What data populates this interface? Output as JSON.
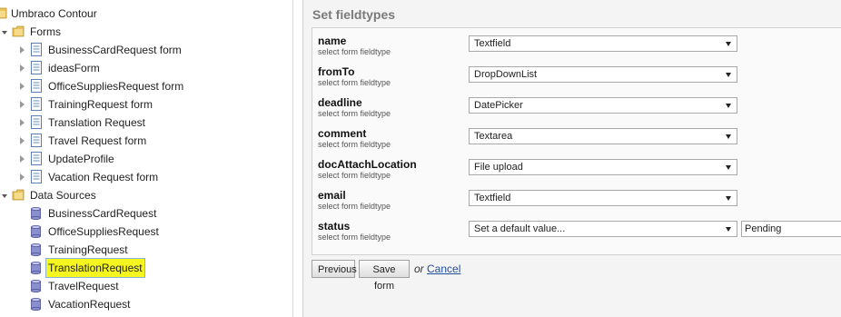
{
  "tree": {
    "root_label": "Umbraco Contour",
    "forms_label": "Forms",
    "forms": [
      "BusinessCardRequest form",
      "ideasForm",
      "OfficeSuppliesRequest form",
      "TrainingRequest form",
      "Translation Request",
      "Travel Request form",
      "UpdateProfile",
      "Vacation Request form"
    ],
    "datasources_label": "Data Sources",
    "datasources": [
      "BusinessCardRequest",
      "OfficeSuppliesRequest",
      "TrainingRequest",
      "TranslationRequest",
      "TravelRequest",
      "VacationRequest"
    ],
    "selected_datasource": "TranslationRequest"
  },
  "panel": {
    "title": "Set fieldtypes",
    "fields": [
      {
        "name": "name",
        "desc": "select form fieldtype",
        "type": "Textfield"
      },
      {
        "name": "fromTo",
        "desc": "select form fieldtype",
        "type": "DropDownList"
      },
      {
        "name": "deadline",
        "desc": "select form fieldtype",
        "type": "DatePicker"
      },
      {
        "name": "comment",
        "desc": "select form fieldtype",
        "type": "Textarea"
      },
      {
        "name": "docAttachLocation",
        "desc": "select form fieldtype",
        "type": "File upload"
      },
      {
        "name": "email",
        "desc": "select form fieldtype",
        "type": "Textfield"
      },
      {
        "name": "status",
        "desc": "select form fieldtype",
        "type": "Set a default value...",
        "default_value": "Pending"
      }
    ],
    "highlighted_field": "docAttachLocation"
  },
  "actions": {
    "previous_label": "Previous",
    "save_label": "Save form",
    "or_text": "or",
    "cancel_label": "Cancel"
  },
  "colors": {
    "highlight": "#f5f51f",
    "link": "#1f4f9a",
    "title": "#7a7a7a"
  },
  "icons": {
    "expanded": "triangle-down-icon",
    "collapsed": "triangle-right-icon",
    "folder": "folder-icon",
    "form": "form-icon",
    "datasource": "database-icon"
  }
}
